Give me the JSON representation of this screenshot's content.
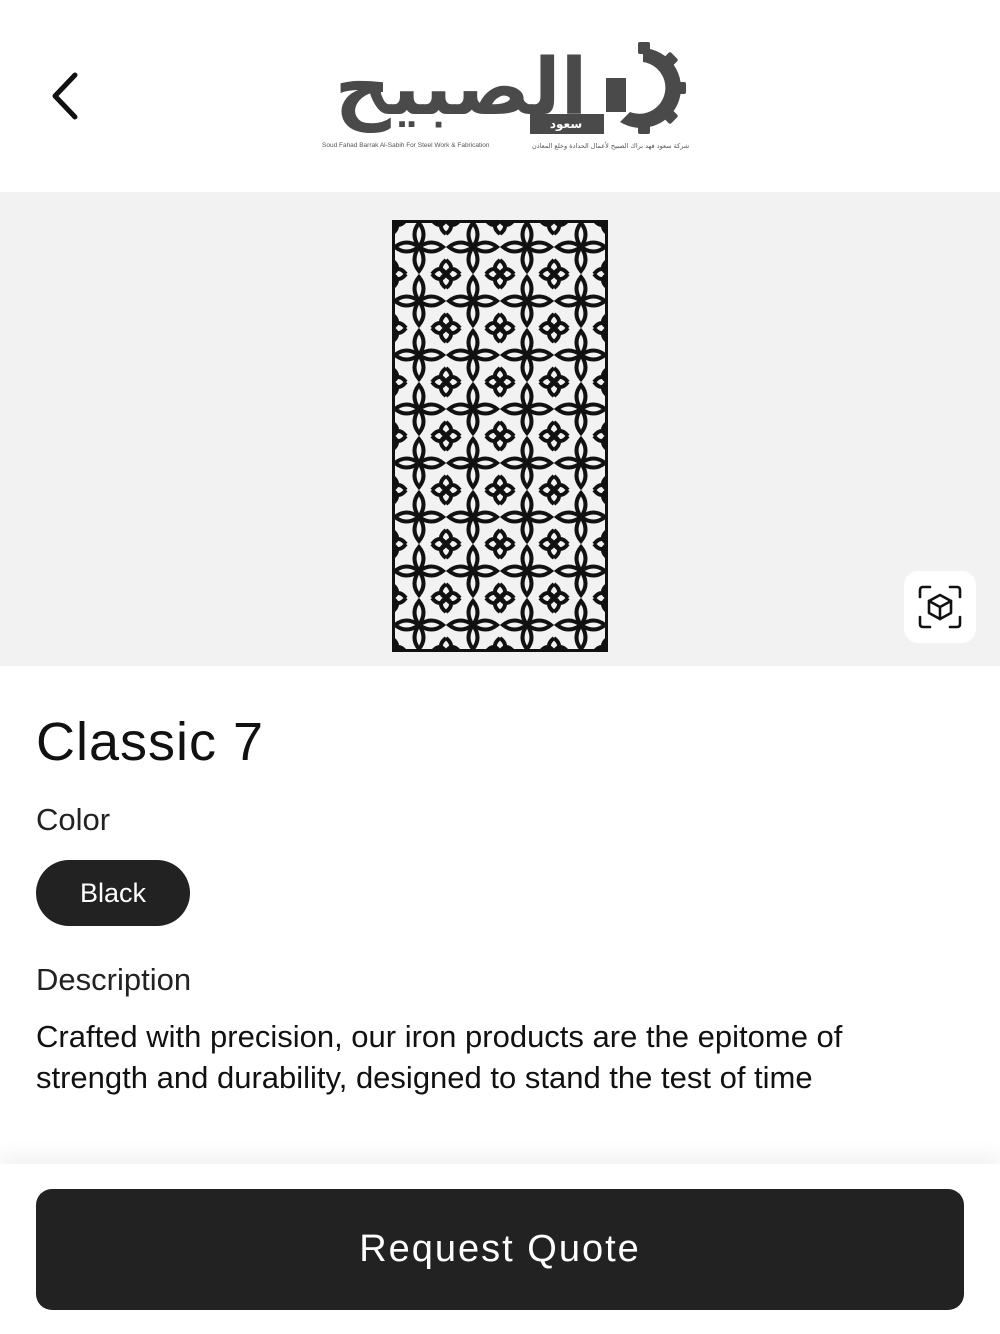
{
  "header": {
    "logo": {
      "arabic_name": "الصبيح",
      "arabic_sub": "سعود",
      "english_caption": "Soud Fahad Barrak Al-Sabih For Steel Work & Fabrication",
      "arabic_caption": "شركة سعود فهد براك الصبيح لأعمال الحدادة وخلع المعادن"
    }
  },
  "product": {
    "title": "Classic 7",
    "color_label": "Color",
    "selected_color": "Black",
    "description_label": "Description",
    "description": "Crafted with precision, our iron products are the epitome of strength and durability, designed to stand the test of time"
  },
  "actions": {
    "request_quote_label": "Request Quote"
  },
  "icons": {
    "back": "chevron-left-icon",
    "ar_view": "cube-ar-icon"
  },
  "colors": {
    "accent_dark": "#222222",
    "image_background": "#f2f2f2",
    "logo_gray": "#4a4a4a"
  }
}
